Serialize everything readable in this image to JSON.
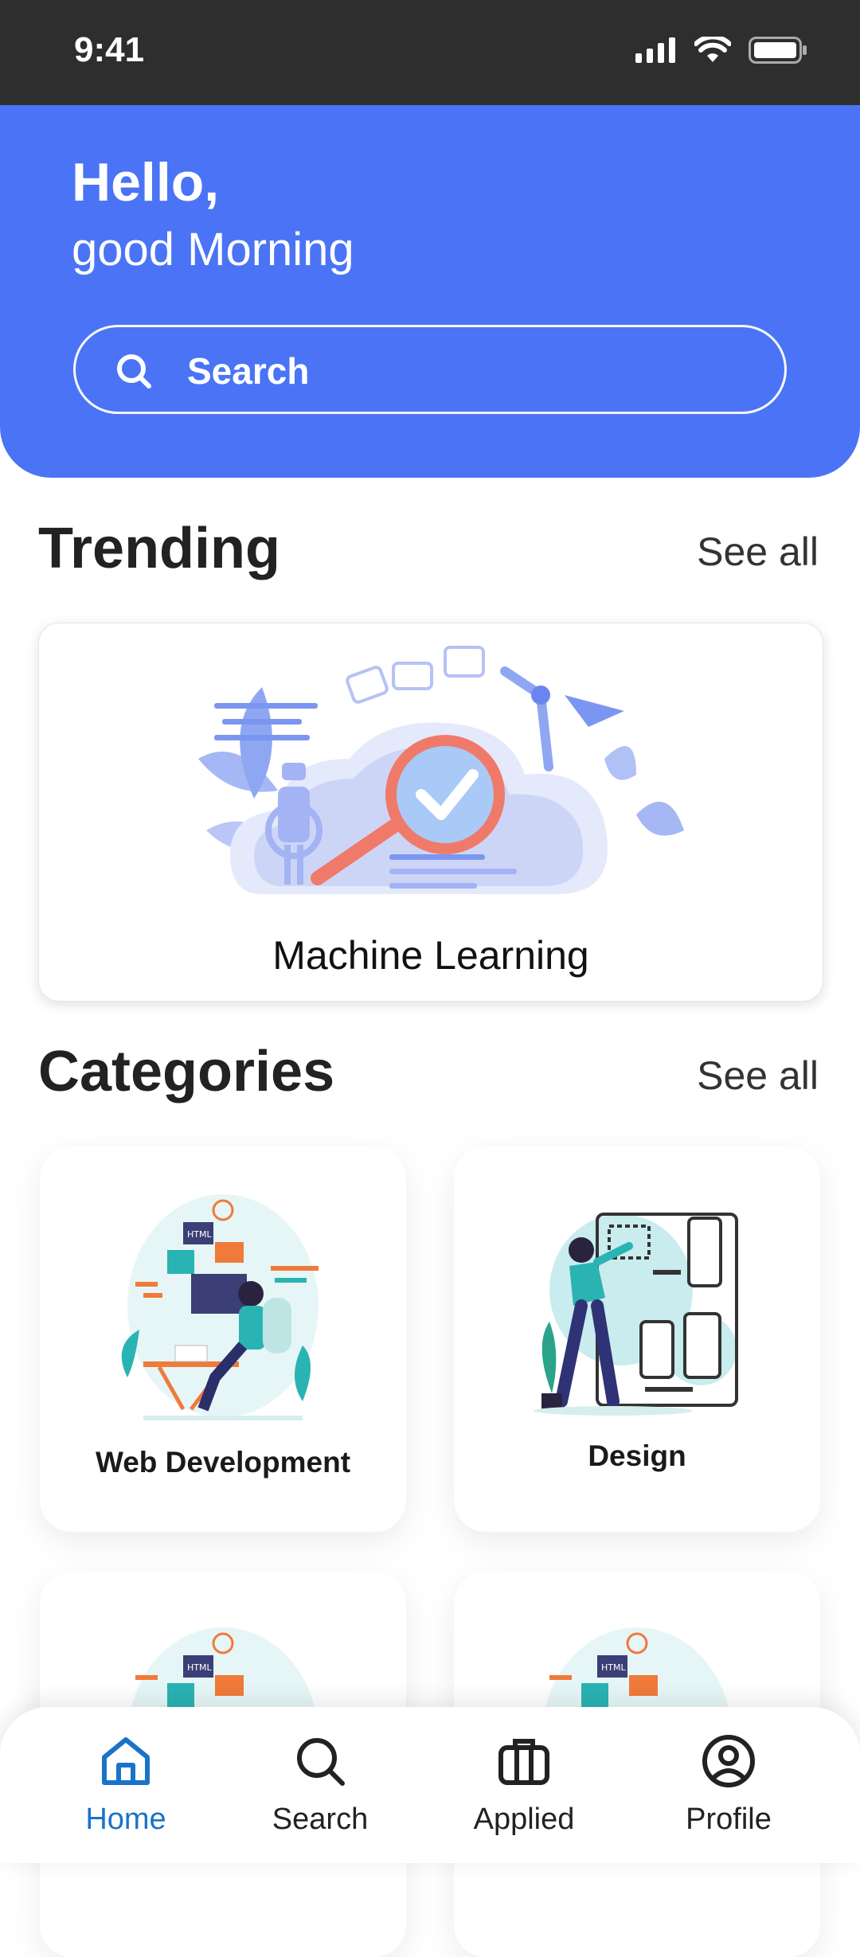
{
  "status_bar": {
    "time": "9:41"
  },
  "header": {
    "greeting": "Hello,",
    "subgreeting": "good Morning",
    "search_placeholder": "Search"
  },
  "trending": {
    "title": "Trending",
    "see_all": "See all",
    "card": {
      "label": "Machine Learning"
    }
  },
  "categories": {
    "title": "Categories",
    "see_all": "See all",
    "items": [
      {
        "label": "Web Development"
      },
      {
        "label": "Design"
      },
      {
        "label": ""
      },
      {
        "label": ""
      }
    ]
  },
  "bottom_nav": {
    "items": [
      {
        "label": "Home",
        "icon": "home-icon",
        "active": true
      },
      {
        "label": "Search",
        "icon": "search-icon",
        "active": false
      },
      {
        "label": "Applied",
        "icon": "briefcase-icon",
        "active": false
      },
      {
        "label": "Profile",
        "icon": "profile-icon",
        "active": false
      }
    ]
  },
  "colors": {
    "header_blue": "#4a74f5",
    "active_nav": "#1a73c9",
    "status_bar": "#2f2e2f"
  }
}
